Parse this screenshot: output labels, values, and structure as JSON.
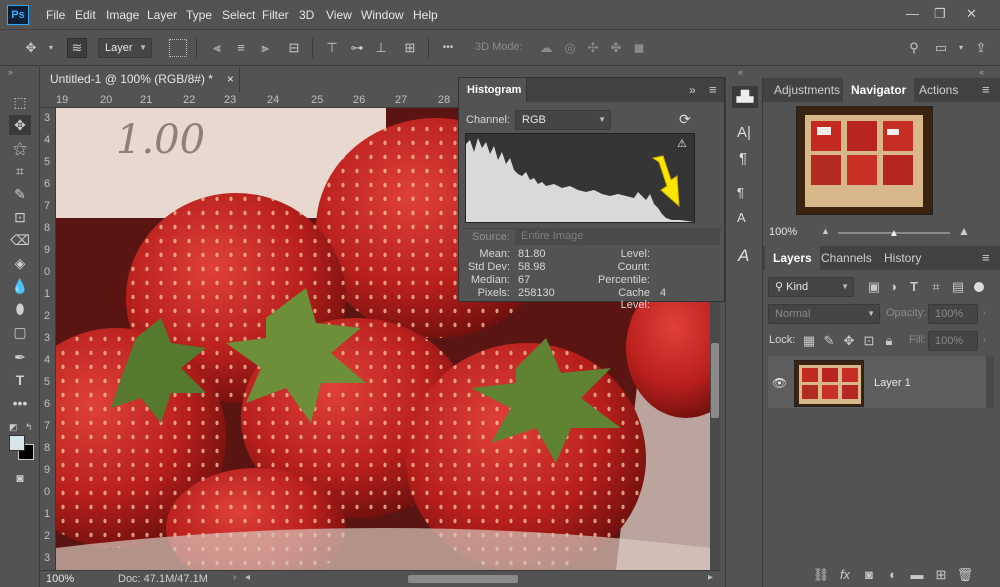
{
  "app": {
    "logo": "Ps"
  },
  "menu": [
    "File",
    "Edit",
    "Image",
    "Layer",
    "Type",
    "Select",
    "Filter",
    "3D",
    "View",
    "Window",
    "Help"
  ],
  "window_controls": {
    "minimize": "—",
    "restore": "❐",
    "close": "✕"
  },
  "options": {
    "layer_select": "Layer",
    "mode_label": "3D Mode:",
    "more": "•••"
  },
  "document": {
    "tab_title": "Untitled-1 @ 100% (RGB/8#) *",
    "tab_close": "×",
    "zoom": "100%",
    "doc_info": "Doc: 47.1M/47.1M",
    "canvas_text": "1.00",
    "ruler_h": [
      "19",
      "20",
      "21",
      "22",
      "23",
      "24",
      "25",
      "26",
      "27",
      "28"
    ],
    "ruler_v": [
      "3",
      "4",
      "5",
      "6",
      "7",
      "8",
      "9",
      "0",
      "1",
      "2",
      "3",
      "4",
      "5",
      "6",
      "7",
      "8",
      "9",
      "0",
      "1",
      "2",
      "3"
    ]
  },
  "histogram": {
    "tab": "Histogram",
    "menu_icon": "≡",
    "collapse_icon": "»",
    "channel_label": "Channel:",
    "channel_value": "RGB",
    "source_label": "Source:",
    "source_value": "Entire Image",
    "stats_left": [
      {
        "label": "Mean:",
        "value": "81.80"
      },
      {
        "label": "Std Dev:",
        "value": "58.98"
      },
      {
        "label": "Median:",
        "value": "67"
      },
      {
        "label": "Pixels:",
        "value": "258130"
      }
    ],
    "stats_right": [
      {
        "label": "Level:",
        "value": ""
      },
      {
        "label": "Count:",
        "value": ""
      },
      {
        "label": "Percentile:",
        "value": ""
      },
      {
        "label": "Cache Level:",
        "value": "4"
      }
    ]
  },
  "right_panel": {
    "top_tabs": [
      "Adjustments",
      "Navigator",
      "Actions"
    ],
    "active_top_tab": "Navigator",
    "navigator_zoom": "100%",
    "layer_tabs": [
      "Layers",
      "Channels",
      "History"
    ],
    "active_layer_tab": "Layers",
    "kind_filter": "Kind",
    "blend_mode": "Normal",
    "opacity_label": "Opacity:",
    "opacity_value": "100%",
    "lock_label": "Lock:",
    "fill_label": "Fill:",
    "fill_value": "100%",
    "layers": [
      {
        "name": "Layer 1",
        "visible": true
      }
    ]
  },
  "colors": {
    "accent": "#31a8ff",
    "bg": "#535353",
    "dark": "#424242"
  }
}
